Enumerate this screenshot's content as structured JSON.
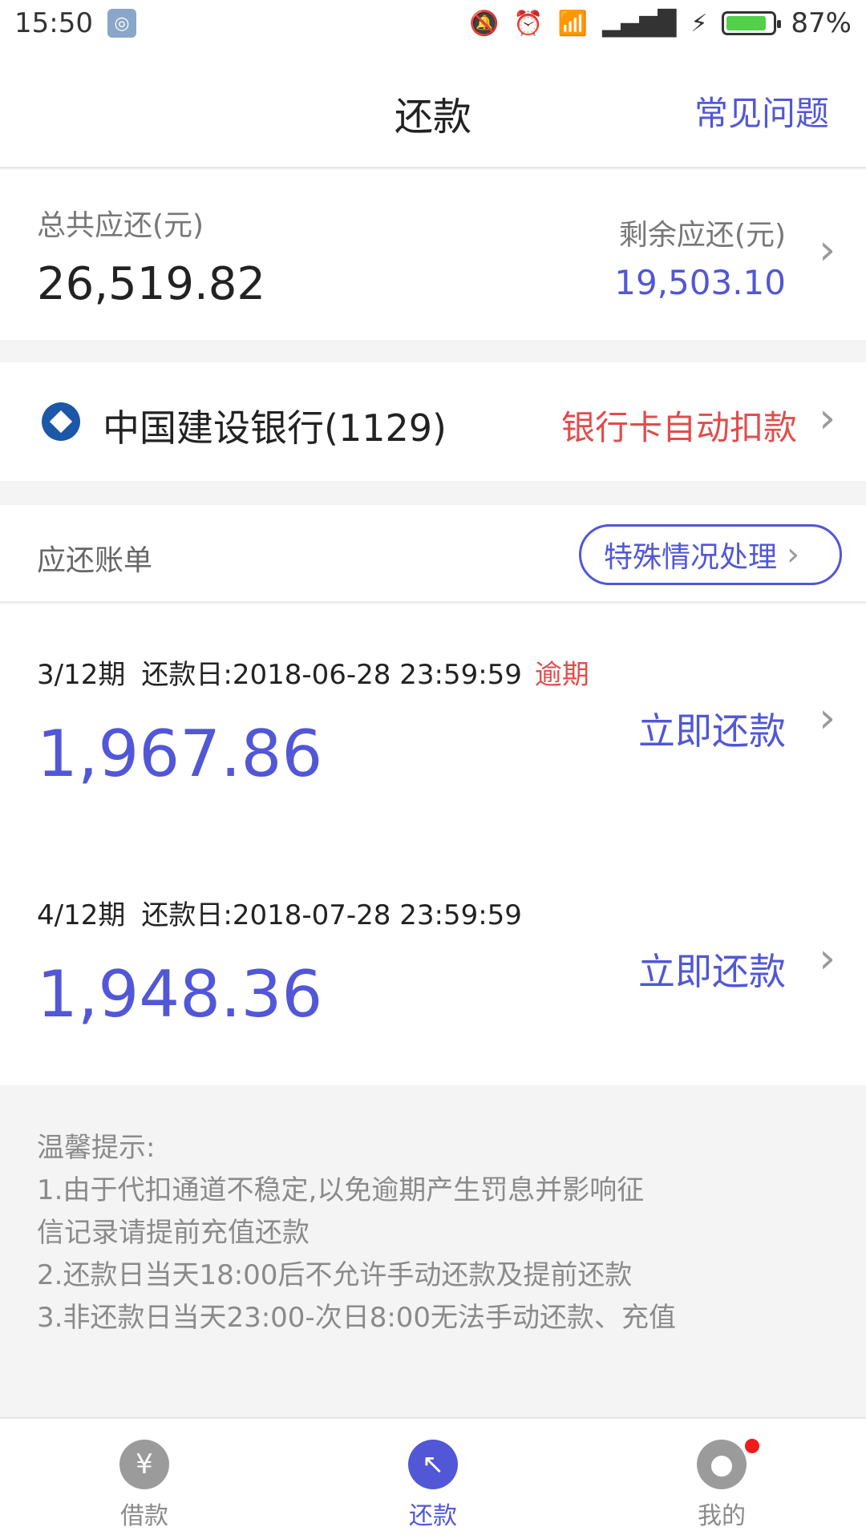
{
  "status": {
    "time": "15:50",
    "battery": "87%",
    "battery_level": 0.87
  },
  "nav": {
    "title": "还款",
    "faq": "常见问题"
  },
  "summary": {
    "total_label": "总共应还(元)",
    "total_value": "26,519.82",
    "remaining_label": "剩余应还(元)",
    "remaining_value": "19,503.10"
  },
  "bank": {
    "name": "中国建设银行(1129)",
    "auto_debit": "银行卡自动扣款"
  },
  "bills": {
    "title": "应还账单",
    "special": "特殊情况处理",
    "items": [
      {
        "period": "3/12期",
        "due": "还款日:2018-06-28 23:59:59",
        "overdue": "逾期",
        "amount": "1,967.86",
        "pay": "立即还款"
      },
      {
        "period": "4/12期",
        "due": "还款日:2018-07-28 23:59:59",
        "overdue": "",
        "amount": "1,948.36",
        "pay": "立即还款"
      }
    ]
  },
  "tips": {
    "title": "温馨提示:",
    "line1a": "1.由于代扣通道不稳定,以免逾期产生罚息并影响征",
    "line1b": "信记录请提前充值还款",
    "line2": "2.还款日当天18:00后不允许手动还款及提前还款",
    "line3": "3.非还款日当天23:00-次日8:00无法手动还款、充值"
  },
  "tabs": [
    {
      "label": "借款",
      "icon": "yuan-icon"
    },
    {
      "label": "还款",
      "icon": "repay-arrow-icon"
    },
    {
      "label": "我的",
      "icon": "user-icon"
    }
  ],
  "colors": {
    "accent": "#5157d6",
    "alert": "#e24c4c"
  }
}
